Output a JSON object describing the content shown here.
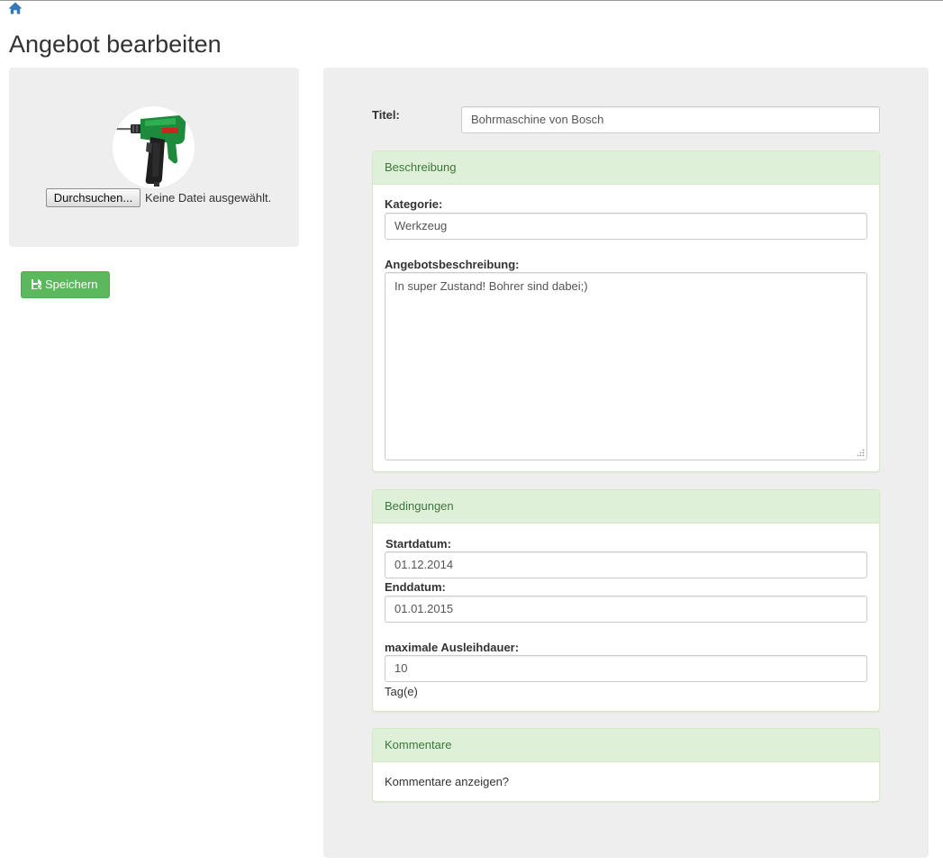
{
  "nav": {
    "home_icon": "home-icon"
  },
  "page": {
    "title": "Angebot bearbeiten"
  },
  "image_upload": {
    "browse_label": "Durchsuchen...",
    "status_text": "Keine Datei ausgewählt.",
    "image_subject": "drill"
  },
  "actions": {
    "save_label": "Speichern",
    "save_icon": "save-icon"
  },
  "form": {
    "title_label": "Titel:",
    "title_value": "Bohrmaschine von Bosch",
    "description_panel": {
      "heading": "Beschreibung",
      "category_label": "Kategorie:",
      "category_value": "Werkzeug",
      "description_label": "Angebotsbeschreibung:",
      "description_value": "In super Zustand! Bohrer sind dabei;)"
    },
    "conditions_panel": {
      "heading": "Bedingungen",
      "start_label": "Startdatum:",
      "start_value": "01.12.2014",
      "end_label": "Enddatum:",
      "end_value": "01.01.2015",
      "max_duration_label": "maximale Ausleihdauer:",
      "max_duration_value": "10",
      "duration_unit": "Tag(e)"
    },
    "comments_panel": {
      "heading": "Kommentare",
      "show_comments_text": "Kommentare anzeigen?"
    }
  },
  "colors": {
    "primary_link": "#337ab7",
    "success_button": "#5cb85c",
    "panel_heading_bg": "#dff0d8",
    "panel_heading_text": "#3c763d",
    "well_bg": "#eeeeee"
  }
}
